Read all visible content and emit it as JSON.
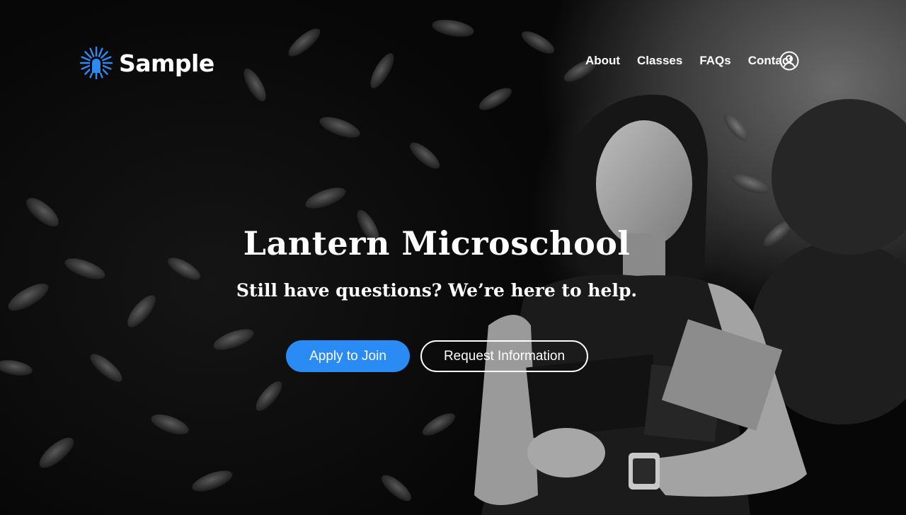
{
  "brand": {
    "name": "Sample",
    "accent": "#2b8bf5"
  },
  "nav": {
    "links": [
      {
        "label": "About"
      },
      {
        "label": "Classes"
      },
      {
        "label": "FAQs"
      },
      {
        "label": "Contact"
      }
    ],
    "account_icon": "user-circle-icon"
  },
  "hero": {
    "title": "Lantern Microschool",
    "subtitle": "Still have questions? We’re here to help.",
    "primary_cta": "Apply to Join",
    "secondary_cta": "Request Information",
    "background": "black-and-white photo of a student holding books in front of leafy foliage"
  }
}
